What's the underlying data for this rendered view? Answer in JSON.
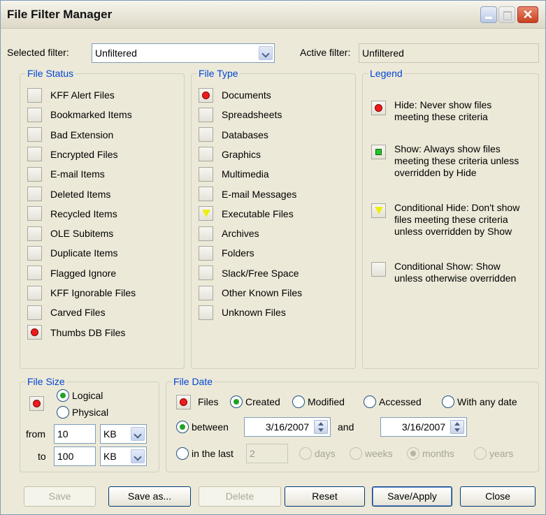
{
  "window": {
    "title": "File Filter Manager"
  },
  "filter": {
    "selected_label": "Selected filter:",
    "selected_value": "Unfiltered",
    "active_label": "Active filter:",
    "active_value": "Unfiltered"
  },
  "file_status": {
    "title": "File Status",
    "items": [
      {
        "label": "KFF Alert Files",
        "state": "none"
      },
      {
        "label": "Bookmarked Items",
        "state": "none"
      },
      {
        "label": "Bad Extension",
        "state": "none"
      },
      {
        "label": "Encrypted Files",
        "state": "none"
      },
      {
        "label": "E-mail Items",
        "state": "none"
      },
      {
        "label": "Deleted Items",
        "state": "none"
      },
      {
        "label": "Recycled Items",
        "state": "none"
      },
      {
        "label": "OLE Subitems",
        "state": "none"
      },
      {
        "label": "Duplicate Items",
        "state": "none"
      },
      {
        "label": "Flagged Ignore",
        "state": "none"
      },
      {
        "label": "KFF Ignorable Files",
        "state": "none"
      },
      {
        "label": "Carved Files",
        "state": "none"
      },
      {
        "label": "Thumbs DB Files",
        "state": "hide"
      }
    ]
  },
  "file_type": {
    "title": "File Type",
    "items": [
      {
        "label": "Documents",
        "state": "hide"
      },
      {
        "label": "Spreadsheets",
        "state": "none"
      },
      {
        "label": "Databases",
        "state": "none"
      },
      {
        "label": "Graphics",
        "state": "none"
      },
      {
        "label": "Multimedia",
        "state": "none"
      },
      {
        "label": "E-mail Messages",
        "state": "none"
      },
      {
        "label": "Executable Files",
        "state": "conditional-hide"
      },
      {
        "label": "Archives",
        "state": "none"
      },
      {
        "label": "Folders",
        "state": "none"
      },
      {
        "label": "Slack/Free Space",
        "state": "none"
      },
      {
        "label": "Other Known Files",
        "state": "none"
      },
      {
        "label": "Unknown Files",
        "state": "none"
      }
    ]
  },
  "legend": {
    "title": "Legend",
    "items": [
      {
        "icon": "hide",
        "line1": "Hide: Never show files",
        "line2": "meeting these criteria",
        "line3": ""
      },
      {
        "icon": "show",
        "line1": "Show: Always show files",
        "line2": "meeting these criteria unless",
        "line3": "overridden by Hide"
      },
      {
        "icon": "conditional-hide",
        "line1": "Conditional Hide: Don't show",
        "line2": "files meeting these criteria",
        "line3": "unless overridden by Show"
      },
      {
        "icon": "conditional-show",
        "line1": "Conditional Show: Show",
        "line2": "unless otherwise overridden",
        "line3": ""
      }
    ]
  },
  "file_size": {
    "title": "File Size",
    "logical": "Logical",
    "physical": "Physical",
    "from_label": "from",
    "from_value": "10",
    "from_unit": "KB",
    "to_label": "to",
    "to_value": "100",
    "to_unit": "KB"
  },
  "file_date": {
    "title": "File Date",
    "files_label": "Files",
    "created": "Created",
    "modified": "Modified",
    "accessed": "Accessed",
    "any_date": "With any date",
    "between_label": "between",
    "start_date": "3/16/2007",
    "and_label": "and",
    "end_date": "3/16/2007",
    "in_last_label": "in the last",
    "in_last_value": "2",
    "days": "days",
    "weeks": "weeks",
    "months": "months",
    "years": "years"
  },
  "buttons": {
    "save": "Save",
    "save_as": "Save as...",
    "delete": "Delete",
    "reset": "Reset",
    "save_apply": "Save/Apply",
    "close": "Close"
  },
  "colors": {
    "hide": "#ec1c1c",
    "show": "#29c329",
    "conditional_hide": "#eeee18",
    "group_title": "#0046d5"
  }
}
